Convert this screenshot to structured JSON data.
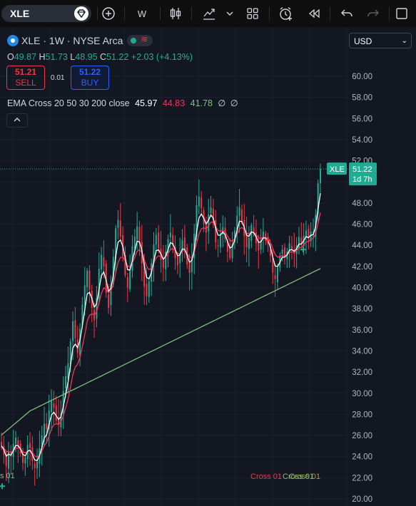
{
  "toolbar": {
    "symbol": "XLE",
    "interval": "W",
    "icons": [
      "diamond-icon",
      "add-symbol-icon",
      "candles-icon",
      "indicators-icon",
      "chevron-down-icon",
      "layout-icon",
      "alert-icon",
      "replay-icon",
      "undo-icon",
      "redo-icon",
      "fullscreen-icon"
    ]
  },
  "legend": {
    "title": "XLE · 1W · NYSE Arca",
    "open_key": "O",
    "open": "49.87",
    "high_key": "H",
    "high": "51.73",
    "low_key": "L",
    "low": "48.95",
    "close_key": "C",
    "close": "51.22",
    "change": "+2.03 (+4.13%)",
    "sell_price": "51.21",
    "sell_label": "SELL",
    "spread": "0.01",
    "buy_price": "51.22",
    "buy_label": "BUY",
    "indicator_name": "EMA Cross 20 50 30 200 close",
    "ema1": "45.97",
    "ema2": "44.83",
    "ema3": "41.78",
    "ema_na1": "∅",
    "ema_na2": "∅"
  },
  "currency": "USD",
  "price_tag": {
    "symbol": "XLE",
    "price": "51.22",
    "countdown": "1d 7h"
  },
  "cross_labels": {
    "left": "s 01",
    "middle": "Cross 01",
    "right": "Cross 01",
    "right2": "Cross 01"
  },
  "colors": {
    "background": "#131722",
    "up": "#22ab94",
    "down": "#f23645",
    "ema_fast": "#ffffff",
    "ema_mid": "#f23658",
    "ema_slow": "#7fbf7f"
  },
  "chart_data": {
    "type": "candlestick",
    "interval": "1W",
    "y_axis_ticks": [
      60,
      58,
      56,
      54,
      52,
      50,
      48,
      46,
      44,
      42,
      40,
      38,
      36,
      34,
      32,
      30,
      28,
      26,
      24,
      22,
      20
    ],
    "y_axis_tick_labels": [
      "60.00",
      "58.00",
      "56.00",
      "54.00",
      "52.00",
      "50.00",
      "48.00",
      "46.00",
      "44.00",
      "42.00",
      "40.00",
      "38.00",
      "36.00",
      "34.00",
      "32.00",
      "30.00",
      "28.00",
      "26.00",
      "24.00",
      "22.00",
      "20.00"
    ],
    "ylim": [
      20,
      60.5
    ],
    "last_price": 51.22,
    "closes": [
      25.0,
      24.2,
      23.1,
      24.5,
      24.0,
      25.2,
      25.8,
      25.0,
      24.3,
      23.4,
      23.9,
      25.1,
      24.8,
      23.6,
      22.9,
      23.5,
      24.8,
      26.0,
      27.1,
      26.6,
      28.4,
      29.3,
      28.6,
      27.4,
      27.0,
      28.1,
      30.2,
      31.6,
      32.8,
      34.9,
      36.8,
      35.2,
      33.8,
      36.1,
      38.4,
      40.2,
      41.6,
      39.8,
      38.1,
      36.9,
      39.0,
      41.8,
      43.1,
      42.0,
      39.5,
      38.1,
      40.3,
      42.9,
      45.6,
      46.4,
      44.8,
      43.0,
      41.2,
      40.0,
      41.6,
      43.9,
      44.8,
      45.8,
      44.2,
      42.3,
      40.1,
      39.2,
      40.6,
      42.3,
      44.1,
      45.0,
      43.7,
      42.6,
      41.9,
      43.4,
      44.6,
      45.2,
      44.0,
      42.8,
      42.1,
      43.2,
      44.5,
      43.6,
      42.2,
      41.4,
      42.8,
      45.1,
      47.8,
      48.6,
      47.5,
      46.0,
      45.2,
      46.9,
      47.6,
      46.1,
      44.3,
      43.9,
      45.0,
      45.7,
      44.6,
      43.4,
      42.8,
      44.1,
      45.4,
      46.8,
      47.6,
      46.2,
      44.9,
      43.8,
      44.7,
      45.9,
      45.1,
      44.2,
      43.5,
      44.4,
      45.3,
      44.6,
      44.1,
      43.0,
      41.4,
      40.8,
      41.9,
      43.0,
      43.6,
      42.9,
      43.4,
      44.2,
      43.7,
      43.2,
      44.0,
      44.8,
      44.1,
      44.9,
      45.4,
      44.6,
      45.3,
      45.1,
      46.9,
      49.87,
      51.22
    ],
    "ema_series": [
      {
        "name": "EMA 20",
        "color": "#ffffff",
        "last": 45.97
      },
      {
        "name": "EMA 50",
        "color": "#f23658",
        "last": 44.83
      },
      {
        "name": "EMA 200",
        "color": "#7fbf7f",
        "last": 41.78
      }
    ]
  }
}
